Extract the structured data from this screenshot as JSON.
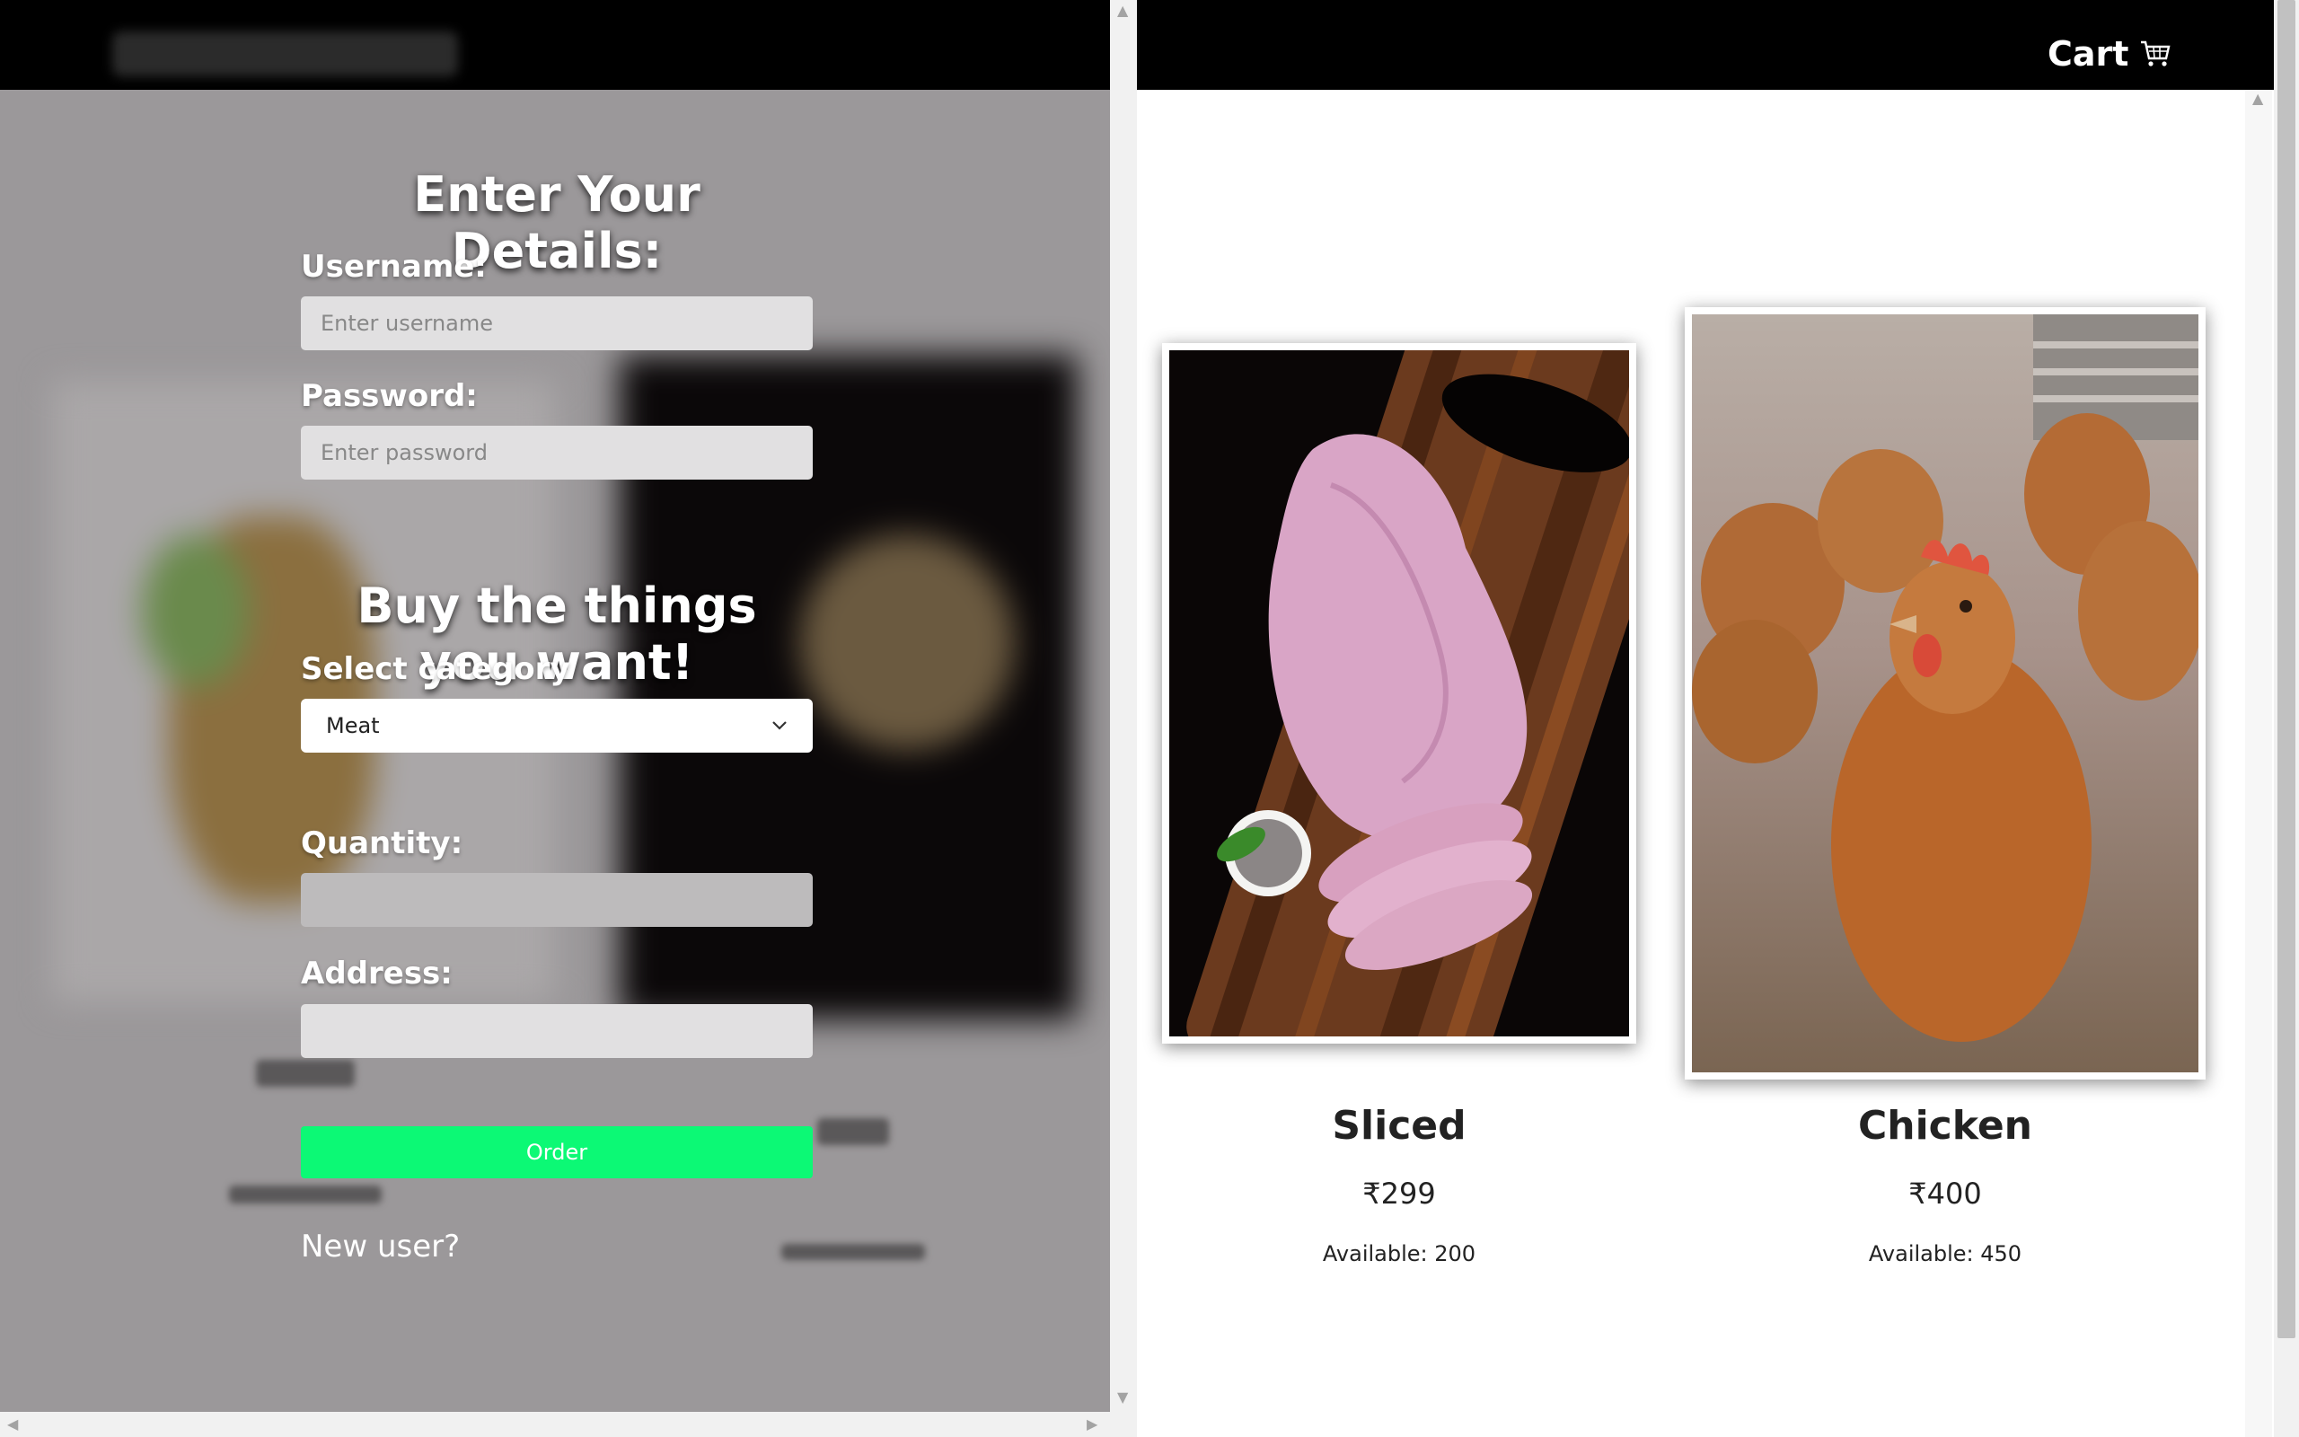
{
  "left": {
    "form": {
      "title": "Enter Your Details:",
      "username_label": "Username:",
      "username_placeholder": "Enter username",
      "password_label": "Password:",
      "password_placeholder": "Enter password",
      "buy_heading": "Buy the things you want!",
      "category_label": "Select category",
      "category_value": "Meat",
      "quantity_label": "Quantity:",
      "address_label": "Address:",
      "order_button": "Order",
      "new_user_link": "New user?"
    }
  },
  "right": {
    "cart_label": "Cart",
    "products": [
      {
        "name": "Sliced",
        "price": "₹299",
        "availability": "Available: 200"
      },
      {
        "name": "Chicken",
        "price": "₹400",
        "availability": "Available: 450"
      }
    ]
  },
  "colors": {
    "order_button": "#0cf975",
    "topbar": "#000000",
    "overlay": "#9b989a"
  },
  "icons": {
    "cart": "shopping-cart-icon",
    "select": "chevron-down-icon"
  }
}
